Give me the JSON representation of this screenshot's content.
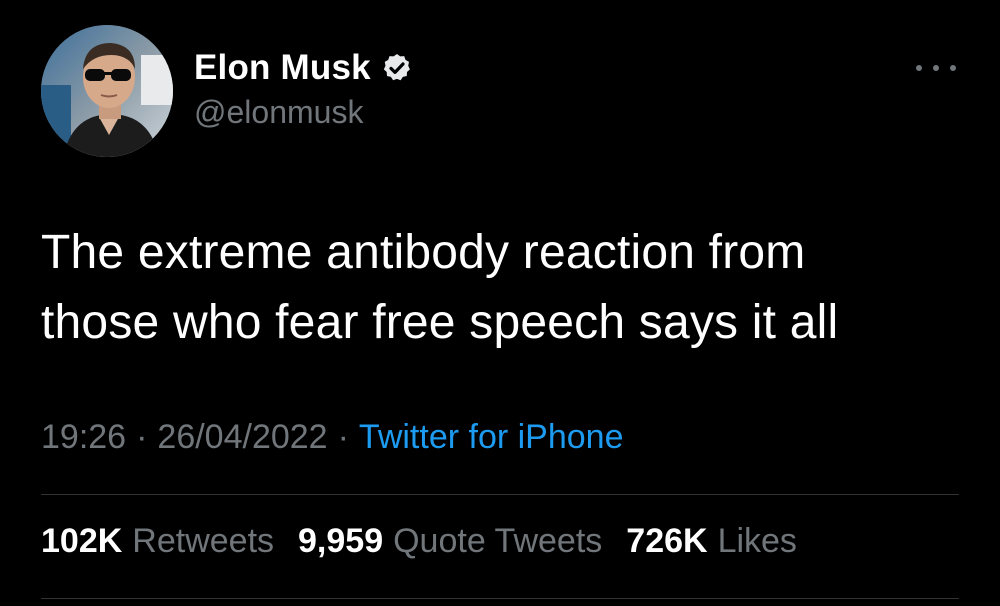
{
  "author": {
    "display_name": "Elon Musk",
    "handle": "@elonmusk",
    "verified": true,
    "verified_color": "#e7e9ea"
  },
  "tweet": {
    "text": "The extreme antibody reaction from\nthose who fear free speech says it all",
    "time": "19:26",
    "separator": "·",
    "date": "26/04/2022",
    "source": "Twitter for iPhone"
  },
  "stats": [
    {
      "count": "102K",
      "label": "Retweets"
    },
    {
      "count": "9,959",
      "label": "Quote Tweets"
    },
    {
      "count": "726K",
      "label": "Likes"
    }
  ],
  "colors": {
    "background": "#000000",
    "primary_text": "#ffffff",
    "secondary_text": "#71767b",
    "link": "#1d9bf0",
    "divider": "#2f3336"
  },
  "icons": {
    "more": "more-horizontal-icon",
    "verified": "verified-badge-icon"
  }
}
